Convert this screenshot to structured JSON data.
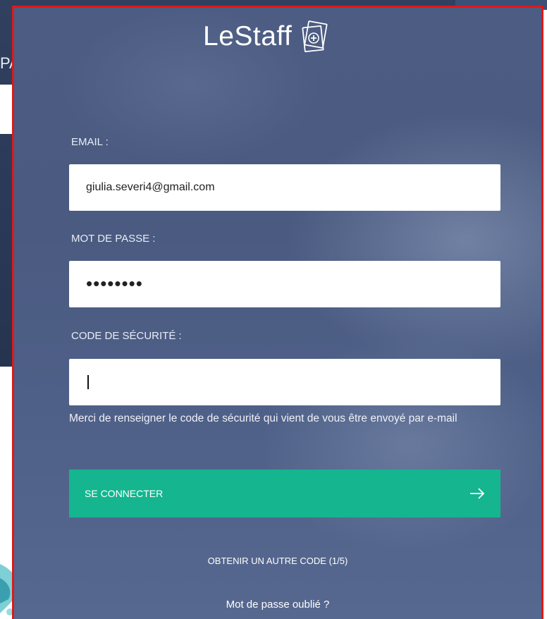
{
  "background": {
    "partial_text": "PA"
  },
  "brand": {
    "name": "LeStaff"
  },
  "form": {
    "email_label": "EMAIL :",
    "email_value": "giulia.severi4@gmail.com",
    "password_label": "MOT DE PASSE :",
    "password_value": "••••••••",
    "security_label": "CODE DE SÉCURITÉ :",
    "security_value": "",
    "helper_text": "Merci de renseigner le code de sécurité qui vient de vous être envoyé par e-mail",
    "submit_label": "SE CONNECTER",
    "resend_link": "OBTENIR UN AUTRE CODE (1/5)",
    "forgot_link": "Mot de passe oublié ?"
  },
  "colors": {
    "accent": "#14b58f",
    "card_border": "#e01818",
    "card_bg": "#4d5c83"
  },
  "icons": {
    "logo": "medical-card-plus-icon",
    "submit": "arrow-right-icon"
  }
}
